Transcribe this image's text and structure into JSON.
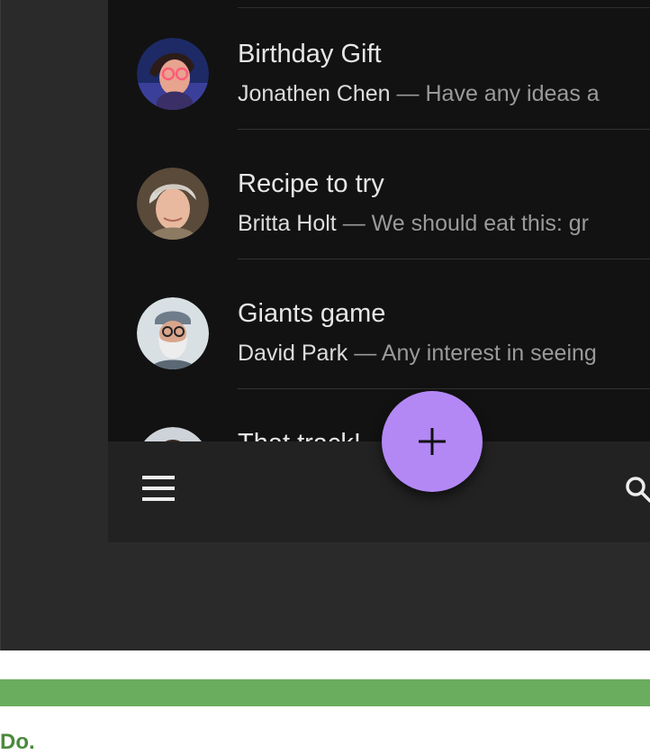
{
  "messages": [
    {
      "subject": "Birthday Gift",
      "sender": "Jonathen Chen",
      "preview": "— Have any ideas a",
      "avatar": "person-with-glasses-avatar"
    },
    {
      "subject": "Recipe to try",
      "sender": "Britta Holt",
      "preview": "— We should eat this: gr",
      "avatar": "woman-short-gray-hair-avatar"
    },
    {
      "subject": "Giants game",
      "sender": "David Park",
      "preview": "— Any interest in seeing",
      "avatar": "bearded-man-cap-avatar"
    },
    {
      "subject": "That track!",
      "avatar": "person-partial-avatar"
    }
  ],
  "bottom_bar": {
    "menu_icon": "menu-icon",
    "search_icon": "search-icon"
  },
  "fab": {
    "icon": "plus-icon",
    "color": "#b388f5"
  },
  "colors": {
    "surface": "#121212",
    "background": "#2a2a2a",
    "guideline_bar": "#6aad5e",
    "caption": "#4a8a3c"
  },
  "caption": {
    "text": "Do."
  }
}
